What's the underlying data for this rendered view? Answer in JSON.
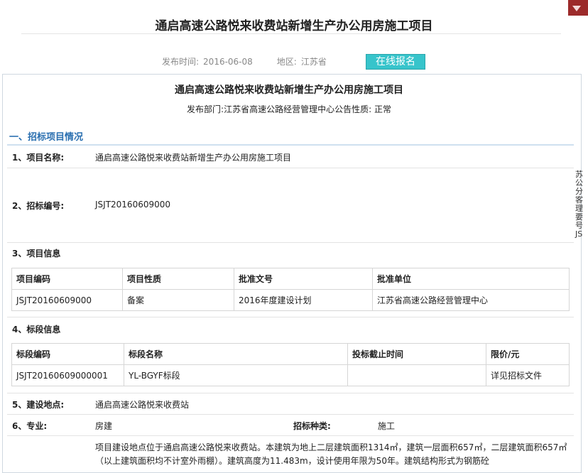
{
  "page_title": "通启高速公路悦来收费站新增生产办公用房施工项目",
  "meta": {
    "date_label": "发布时间:",
    "date_value": "2016-06-08",
    "region_label": "地区:",
    "region_value": "江苏省",
    "signup_label": "在线报名"
  },
  "card": {
    "title": "通启高速公路悦来收费站新增生产办公用房施工项目",
    "sub": "发布部门:江苏省高速公路经营管理中心公告性质:  正常"
  },
  "section1": "一、招标项目情况",
  "rows": {
    "r1_label": "1、项目名称:",
    "r1_value": "通启高速公路悦来收费站新增生产办公用房施工项目",
    "r2_label": "2、招标编号:",
    "r2_value": "JSJT20160609000",
    "r3_label": "3、项目信息",
    "r4_label": "4、标段信息",
    "r5_label": "5、建设地点:",
    "r5_value": "通启高速公路悦来收费站",
    "r6_label": "6、专业:",
    "r6_value": "房建",
    "r6_type_label": "招标种类:",
    "r6_type_value": "施工"
  },
  "project_table": {
    "headers": [
      "项目编码",
      "项目性质",
      "批准文号",
      "批准单位"
    ],
    "row": [
      "JSJT20160609000",
      "备案",
      "2016年度建设计划",
      "江苏省高速公路经营管理中心"
    ]
  },
  "section_table": {
    "headers": [
      "标段编码",
      "标段名称",
      "投标截止时间",
      "限价/元"
    ],
    "row": [
      "JSJT20160609000001",
      "YL-BGYF标段",
      "",
      "详见招标文件"
    ]
  },
  "description": "项目建设地点位于通启高速公路悦来收费站。本建筑为地上二层建筑面积1314㎡，建筑一层面积657㎡，二层建筑面积657㎡（以上建筑面积均不计室外雨棚）。建筑高度为11.483m，设计使用年限为50年。建筑结构形式为钢筋砼",
  "side_text": "苏公分客理要号JS"
}
